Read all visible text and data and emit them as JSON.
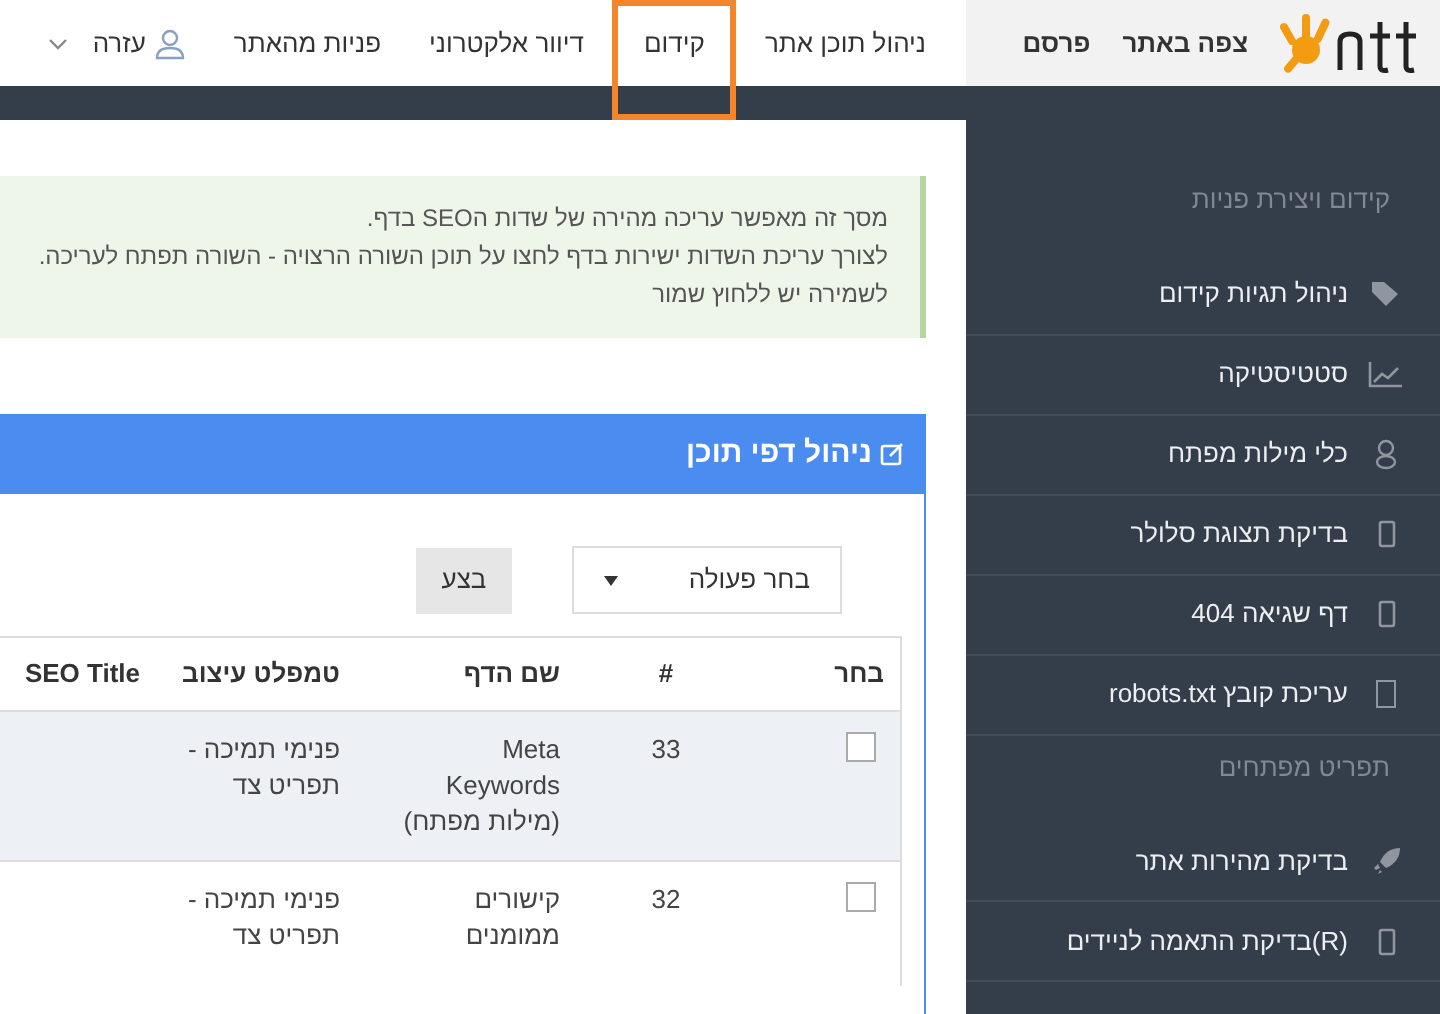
{
  "brand": {
    "actions": [
      "צפה באתר",
      "פרסם"
    ]
  },
  "nav": [
    {
      "label": "ניהול תוכן אתר",
      "selected": false
    },
    {
      "label": "קידום",
      "selected": true
    },
    {
      "label": "דיוור אלקטרוני",
      "selected": false
    },
    {
      "label": "פניות מהאתר",
      "selected": false
    }
  ],
  "user_menu": {
    "label": "עזרה"
  },
  "alert": {
    "lines": [
      "מסך זה מאפשר עריכה מהירה של שדות הSEO בדף.",
      "לצורך עריכת השדות ישירות בדף לחצו על תוכן השורה הרצויה - השורה תפתח לעריכה.",
      "לשמירה יש ללחוץ שמור"
    ]
  },
  "panel": {
    "title": "ניהול דפי תוכן",
    "action_select": "בחר פעולה",
    "apply_button": "בצע"
  },
  "table": {
    "columns": [
      "בחר",
      "#",
      "שם הדף",
      "טמפלט עיצוב",
      "SEO Title"
    ],
    "rows": [
      {
        "checked": false,
        "highlighted": true,
        "id": "33",
        "page_name": "Meta Keywords (מילות מפתח)",
        "template": "פנימי תמיכה - תפריט צד"
      },
      {
        "checked": false,
        "highlighted": false,
        "id": "32",
        "page_name": "קישורים ממומנים",
        "template": "פנימי תמיכה - תפריט צד"
      }
    ]
  },
  "sidebar": [
    {
      "kind": "header",
      "label": "קידום ויצירת פניות"
    },
    {
      "kind": "item",
      "label": "ניהול תגיות קידום"
    },
    {
      "kind": "item",
      "label": "סטטיסטיקה"
    },
    {
      "kind": "item",
      "label": "כלי מילות מפתח"
    },
    {
      "kind": "item",
      "label": "בדיקת תצוגת סלולר"
    },
    {
      "kind": "item",
      "label": "דף שגיאה 404"
    },
    {
      "kind": "item",
      "label": "עריכת קובץ robots.txt"
    },
    {
      "kind": "header",
      "label": "תפריט מפתחים"
    },
    {
      "kind": "item",
      "label": "בדיקת מהירות אתר"
    },
    {
      "kind": "item",
      "label": "(R)בדיקת התאמה לניידים"
    }
  ]
}
